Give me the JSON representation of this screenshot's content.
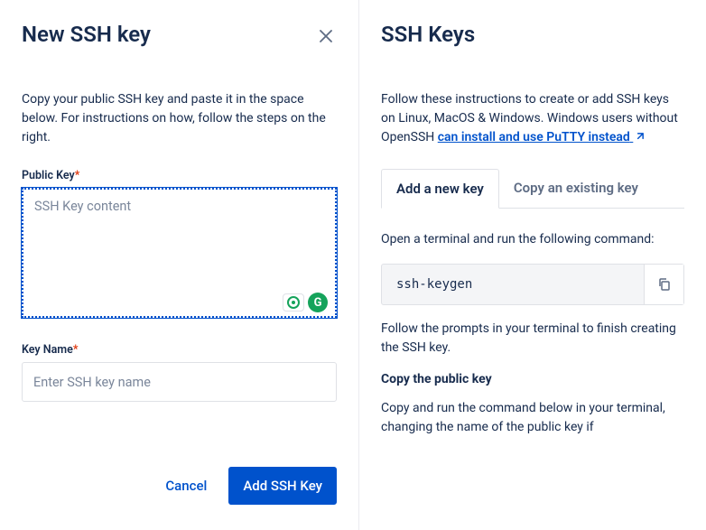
{
  "modal": {
    "title": "New SSH key",
    "intro": "Copy your public SSH key and paste it in the space below. For instructions on how, follow the steps on the right.",
    "publicKey": {
      "label": "Public Key",
      "required": "*",
      "placeholder": "SSH Key content",
      "value": ""
    },
    "keyName": {
      "label": "Key Name",
      "required": "*",
      "placeholder": "Enter SSH key name",
      "value": ""
    },
    "actions": {
      "cancel": "Cancel",
      "submit": "Add SSH Key"
    }
  },
  "help": {
    "title": "SSH Keys",
    "intro_pre": "Follow these instructions to create or add SSH keys on Linux, MacOS & Windows. Windows users without OpenSSH ",
    "intro_link": "can install and use PuTTY instead",
    "tabs": {
      "add": "Add a new key",
      "copy": "Copy an existing key"
    },
    "step1_text": "Open a terminal and run the following command:",
    "command1": "ssh-keygen",
    "step1_followup": "Follow the prompts in your terminal to finish creating the SSH key.",
    "section2_head": "Copy the public key",
    "step2_text": "Copy and run the command below in your terminal, changing the name of the public key if"
  }
}
